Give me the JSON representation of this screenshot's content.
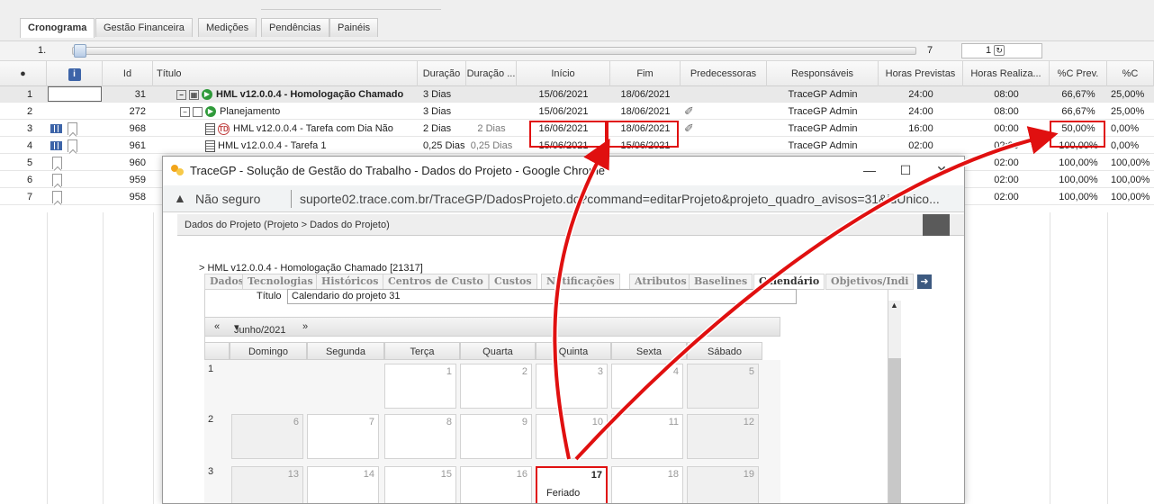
{
  "tabs": [
    {
      "label": "Cronograma",
      "active": true
    },
    {
      "label": "Gestão Financeira"
    },
    {
      "label": "Medições"
    },
    {
      "label": "Pendências"
    },
    {
      "label": "Painéis"
    }
  ],
  "toolbar": {
    "level": "1.",
    "count": "7",
    "page": "1"
  },
  "columns": [
    "Id",
    "Título",
    "Duração",
    "Duração ...",
    "Início",
    "Fim",
    "Predecessoras",
    "Responsáveis",
    "Horas Previstas",
    "Horas Realiza...",
    "%C Prev.",
    "%C"
  ],
  "rows": [
    {
      "n": "1",
      "id": "31",
      "title": "HML v12.0.0.4 - Homologação Chamado",
      "dur": "3 Dias",
      "dur2": "",
      "ini": "15/06/2021",
      "fim": "18/06/2021",
      "resp": "TraceGP Admin",
      "hp": "24:00",
      "hr": "08:00",
      "cprev": "66,67%",
      "c": "25,00%"
    },
    {
      "n": "2",
      "id": "272",
      "title": "Planejamento",
      "dur": "3 Dias",
      "dur2": "",
      "ini": "15/06/2021",
      "fim": "18/06/2021",
      "resp": "TraceGP Admin",
      "hp": "24:00",
      "hr": "08:00",
      "cprev": "66,67%",
      "c": "25,00%"
    },
    {
      "n": "3",
      "id": "968",
      "title": "HML v12.0.0.4 - Tarefa com Dia Não",
      "dur": "2 Dias",
      "dur2": "2 Dias",
      "ini": "16/06/2021",
      "fim": "18/06/2021",
      "resp": "TraceGP Admin",
      "hp": "16:00",
      "hr": "00:00",
      "cprev": "50,00%",
      "c": "0,00%"
    },
    {
      "n": "4",
      "id": "961",
      "title": "HML v12.0.0.4 - Tarefa 1",
      "dur": "0,25 Dias",
      "dur2": "0,25 Dias",
      "ini": "15/06/2021",
      "fim": "15/06/2021",
      "resp": "TraceGP Admin",
      "hp": "02:00",
      "hr": "02:00",
      "cprev": "100,00%",
      "c": "0,00%"
    },
    {
      "n": "5",
      "id": "960",
      "title": "",
      "dur": "",
      "dur2": "",
      "ini": "",
      "fim": "",
      "resp": "",
      "hp": "",
      "hr": "02:00",
      "cprev": "100,00%",
      "c": "100,00%"
    },
    {
      "n": "6",
      "id": "959",
      "title": "",
      "dur": "",
      "dur2": "",
      "ini": "",
      "fim": "",
      "resp": "",
      "hp": "",
      "hr": "02:00",
      "cprev": "100,00%",
      "c": "100,00%"
    },
    {
      "n": "7",
      "id": "958",
      "title": "",
      "dur": "",
      "dur2": "",
      "ini": "",
      "fim": "",
      "resp": "",
      "hp": "",
      "hr": "02:00",
      "cprev": "100,00%",
      "c": "100,00%"
    }
  ],
  "popup": {
    "title": "TraceGP - Solução de Gestão do Trabalho - Dados do Projeto - Google Chrome",
    "not_secure": "Não seguro",
    "url": "suporte02.trace.com.br/TraceGP/DadosProjeto.do?command=editarProjeto&projeto_quadro_avisos=31&idUnico...",
    "breadcrumb": "Dados do Projeto  (Projeto > Dados do Projeto)",
    "project": "> HML v12.0.0.4 - Homologação Chamado [21317]",
    "tabs": [
      "Dados",
      "Tecnologias",
      "Históricos",
      "Centros de Custo",
      "Custos",
      "Notificações",
      "Atributos",
      "Baselines",
      "Calendário",
      "Objetivos/Indi"
    ],
    "titulo_label": "Título",
    "titulo_value": "Calendario do projeto 31",
    "month": "Junho/2021",
    "weekdays": [
      "Domingo",
      "Segunda",
      "Terça",
      "Quarta",
      "Quinta",
      "Sexta",
      "Sábado"
    ],
    "weeks": [
      {
        "n": "1",
        "days": [
          "",
          "",
          "1",
          "2",
          "3",
          "4",
          "5"
        ]
      },
      {
        "n": "2",
        "days": [
          "6",
          "7",
          "8",
          "9",
          "10",
          "11",
          "12"
        ]
      },
      {
        "n": "3",
        "days": [
          "13",
          "14",
          "15",
          "16",
          "17",
          "18",
          "19"
        ]
      }
    ],
    "holiday_note": "Feriado"
  },
  "colors": {
    "accent": "#e01010",
    "green": "#2f9a3a",
    "blue": "#3d64a8"
  }
}
